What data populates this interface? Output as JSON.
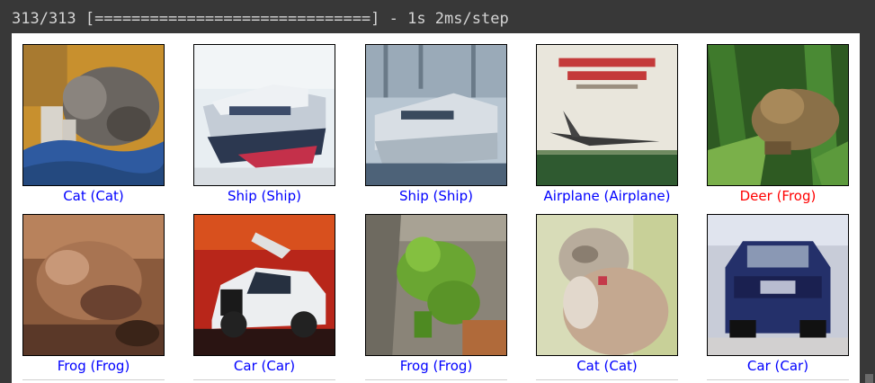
{
  "console": {
    "progress_text": "313/313 [==============================] - 1s 2ms/step"
  },
  "grid": {
    "items": [
      {
        "caption": "Cat (Cat)",
        "correct": true,
        "subject": "cat"
      },
      {
        "caption": "Ship (Ship)",
        "correct": true,
        "subject": "ship"
      },
      {
        "caption": "Ship (Ship)",
        "correct": true,
        "subject": "ship"
      },
      {
        "caption": "Airplane (Airplane)",
        "correct": true,
        "subject": "airplane"
      },
      {
        "caption": "Deer (Frog)",
        "correct": false,
        "subject": "frog"
      },
      {
        "caption": "Frog (Frog)",
        "correct": true,
        "subject": "frog"
      },
      {
        "caption": "Car (Car)",
        "correct": true,
        "subject": "car"
      },
      {
        "caption": "Frog (Frog)",
        "correct": true,
        "subject": "frog"
      },
      {
        "caption": "Cat (Cat)",
        "correct": true,
        "subject": "cat"
      },
      {
        "caption": "Car (Car)",
        "correct": true,
        "subject": "car"
      }
    ]
  },
  "colors": {
    "correct_caption": "#0000ff",
    "wrong_caption": "#ff0000",
    "console_bg": "#383838",
    "console_text": "#d4d4d4"
  }
}
